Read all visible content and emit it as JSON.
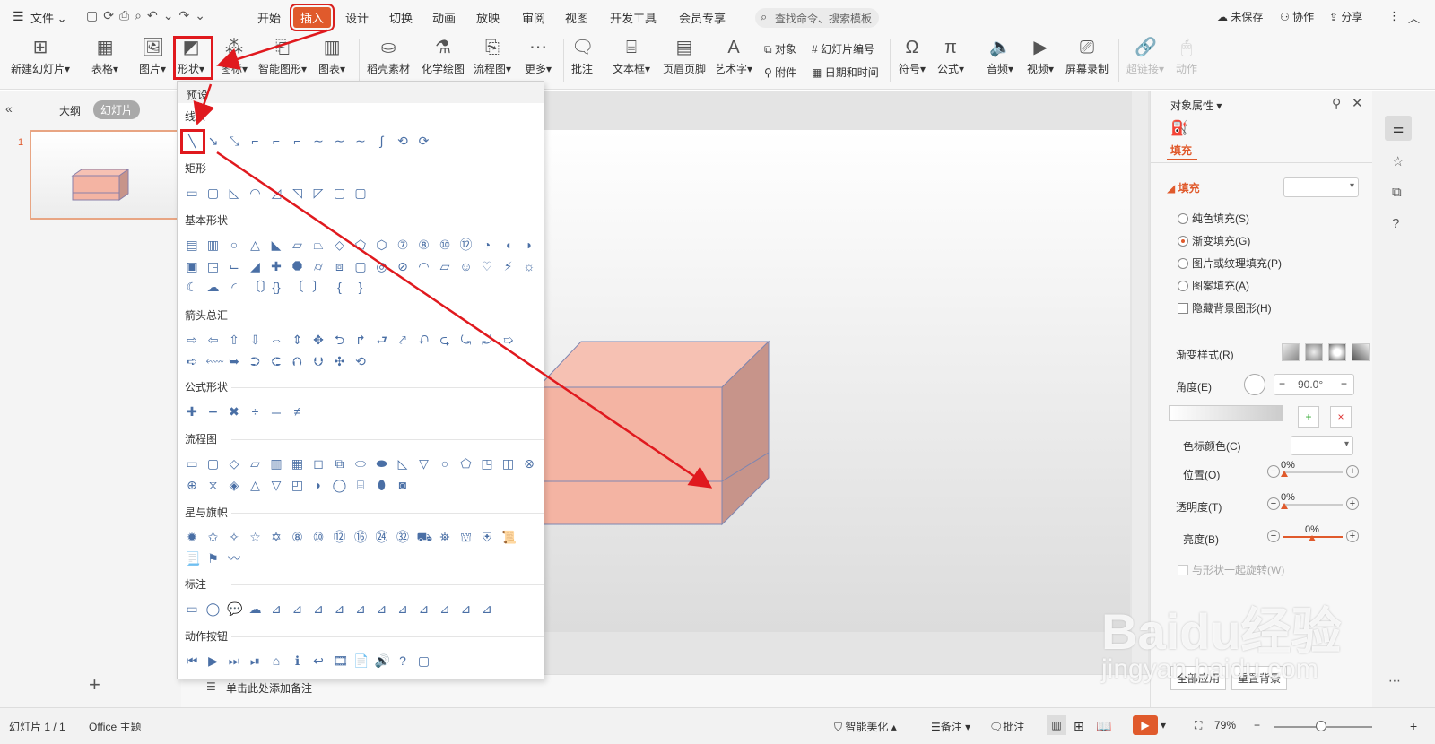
{
  "menubar": {
    "file_label": "文件",
    "tabs": [
      "开始",
      "插入",
      "设计",
      "切换",
      "动画",
      "放映",
      "审阅",
      "视图",
      "开发工具",
      "会员专享"
    ],
    "active_tab": "插入",
    "search_placeholder": "查找命令、搜索模板",
    "unsaved": "未保存",
    "collab": "协作",
    "share": "分享"
  },
  "ribbon": {
    "new_slide": "新建幻灯片",
    "table": "表格",
    "picture": "图片",
    "shape": "形状",
    "icon": "图标",
    "smartart": "智能图形",
    "chart": "图表",
    "material": "稻壳素材",
    "chem": "化学绘图",
    "flow": "流程图",
    "more": "更多",
    "comment": "批注",
    "textbox": "文本框",
    "header_footer": "页眉页脚",
    "wordart": "艺术字",
    "object": "对象",
    "attachment": "附件",
    "slide_number": "幻灯片编号",
    "datetime": "日期和时间",
    "symbol": "符号",
    "formula": "公式",
    "audio": "音频",
    "video": "视频",
    "screen_rec": "屏幕录制",
    "hyperlink": "超链接",
    "action": "动作"
  },
  "leftpane": {
    "tab_outline": "大纲",
    "tab_slides": "幻灯片",
    "slide_number": "1"
  },
  "dropdown": {
    "preset_label": "预设",
    "sections": [
      {
        "title": "线条",
        "rows": [
          [
            "╲",
            "↘",
            "⤡",
            "⌐",
            "⌐",
            "⌐",
            "∼",
            "∼",
            "∼",
            "∫",
            "⟲",
            "⟳"
          ]
        ]
      },
      {
        "title": "矩形",
        "rows": [
          [
            "▭",
            "▢",
            "◺",
            "◠",
            "◿",
            "◹",
            "◸",
            "▢",
            "▢"
          ]
        ]
      },
      {
        "title": "基本形状",
        "rows": [
          [
            "▤",
            "▥",
            "○",
            "△",
            "◣",
            "▱",
            "⏢",
            "◇",
            "⬠",
            "⬡",
            "⑦",
            "⑧",
            "⑩",
            "⑫",
            "◔",
            "◖",
            "◗"
          ],
          [
            "▣",
            "◲",
            "⌙",
            "◢",
            "✚",
            "⯃",
            "⌭",
            "⧈",
            "▢",
            "◎",
            "⊘",
            "◠",
            "▱",
            "☺",
            "♡",
            "⚡",
            "☼"
          ],
          [
            "☾",
            "☁",
            "◜",
            "〔〕",
            "{}",
            "〔",
            "〕",
            "{",
            "}"
          ]
        ]
      },
      {
        "title": "箭头总汇",
        "rows": [
          [
            "⇨",
            "⇦",
            "⇧",
            "⇩",
            "⇔",
            "⇕",
            "✥",
            "⮌",
            "↱",
            "⮐",
            "⤤",
            "⮏",
            "⮎",
            "⤿",
            "⤾",
            "➯"
          ],
          [
            "➪",
            "⬳",
            "➥",
            "⮊",
            "⮈",
            "⮉",
            "⮋",
            "✣",
            "⟲"
          ]
        ]
      },
      {
        "title": "公式形状",
        "rows": [
          [
            "✚",
            "━",
            "✖",
            "÷",
            "═",
            "≠"
          ]
        ]
      },
      {
        "title": "流程图",
        "rows": [
          [
            "▭",
            "▢",
            "◇",
            "▱",
            "▥",
            "▦",
            "◻",
            "⧉",
            "⬭",
            "⬬",
            "◺",
            "▽",
            "○",
            "⬠",
            "◳",
            "◫",
            "⊗"
          ],
          [
            "⊕",
            "⧖",
            "◈",
            "△",
            "▽",
            "◰",
            "◗",
            "◯",
            "⌸",
            "⬮",
            "◙"
          ]
        ]
      },
      {
        "title": "星与旗帜",
        "rows": [
          [
            "✹",
            "✩",
            "✧",
            "☆",
            "✡",
            "⑧",
            "⑩",
            "⑫",
            "⑯",
            "㉔",
            "㉜",
            "⛟",
            "⛯",
            "⛫",
            "⛨",
            "📜"
          ],
          [
            "📃",
            "⚑",
            "〰"
          ]
        ]
      },
      {
        "title": "标注",
        "rows": [
          [
            "▭",
            "◯",
            "💬",
            "☁",
            "⊿",
            "⊿",
            "⊿",
            "⊿",
            "⊿",
            "⊿",
            "⊿",
            "⊿",
            "⊿",
            "⊿",
            "⊿"
          ]
        ]
      },
      {
        "title": "动作按钮",
        "rows": [
          [
            "⏮",
            "▶",
            "⏭",
            "⏯",
            "⌂",
            "ℹ",
            "↩",
            "🎞",
            "📄",
            "🔊",
            "?",
            "▢"
          ]
        ]
      }
    ]
  },
  "rpanel": {
    "title": "对象属性",
    "fill_tab": "填充",
    "fill_header": "填充",
    "options": [
      "纯色填充(S)",
      "渐变填充(G)",
      "图片或纹理填充(P)",
      "图案填充(A)"
    ],
    "selected_option": 1,
    "hide_bg": "隐藏背景图形(H)",
    "gradient_style": "渐变样式(R)",
    "angle": "角度(E)",
    "angle_value": "90.0°",
    "stop_color": "色标颜色(C)",
    "position": "位置(O)",
    "position_value": "0%",
    "transparency": "透明度(T)",
    "transparency_value": "0%",
    "brightness": "亮度(B)",
    "brightness_value": "0%",
    "rotate_with": "与形状一起旋转(W)",
    "apply_all": "全部应用",
    "reset": "重置背景"
  },
  "notes": {
    "placeholder": "单击此处添加备注"
  },
  "status": {
    "slide_info": "幻灯片 1 / 1",
    "theme": "Office 主题",
    "beautify": "智能美化",
    "notes": "备注",
    "comments": "批注",
    "zoom": "79%"
  },
  "watermark": {
    "text1": "Baidu经验",
    "text2": "jingyan.baidu.com"
  },
  "colors": {
    "accent": "#e05a2c",
    "highlight_red": "#e0191e",
    "box_front": "#f4b4a3",
    "box_top": "#f6c1b3",
    "box_side": "#c7948a"
  }
}
